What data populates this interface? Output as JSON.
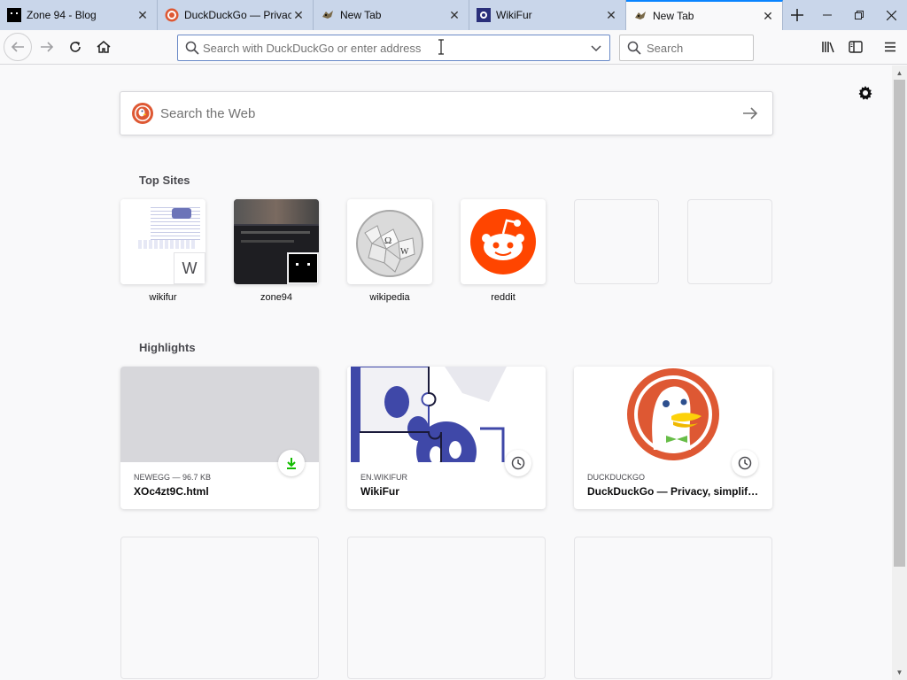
{
  "tabs": [
    {
      "title": "Zone 94 - Blog",
      "favicon": "zone94-icon"
    },
    {
      "title": "DuckDuckGo — Privacy, simplified",
      "favicon": "duckduckgo-icon"
    },
    {
      "title": "New Tab",
      "favicon": "fox-icon"
    },
    {
      "title": "WikiFur",
      "favicon": "wikifur-icon"
    },
    {
      "title": "New Tab",
      "favicon": "fox-icon",
      "active": true
    }
  ],
  "urlbar": {
    "placeholder": "Search with DuckDuckGo or enter address"
  },
  "searchbar": {
    "placeholder": "Search"
  },
  "websearch": {
    "placeholder": "Search the Web"
  },
  "sections": {
    "top_sites": "Top Sites",
    "highlights": "Highlights"
  },
  "top_sites": [
    {
      "label": "wikifur",
      "badge_letter": "W"
    },
    {
      "label": "zone94"
    },
    {
      "label": "wikipedia"
    },
    {
      "label": "reddit"
    }
  ],
  "highlights": [
    {
      "source": "NEWEGG — 96.7 KB",
      "title": "XOc4zt9C.html",
      "badge": "download-icon"
    },
    {
      "source": "EN.WIKIFUR",
      "title": "WikiFur",
      "badge": "clock-icon"
    },
    {
      "source": "DUCKDUCKGO",
      "title": "DuckDuckGo — Privacy, simplified.",
      "badge": "clock-icon"
    }
  ],
  "colors": {
    "accent": "#0a84ff",
    "reddit": "#ff4500",
    "ddg": "#de5833",
    "download": "#12bc00"
  }
}
